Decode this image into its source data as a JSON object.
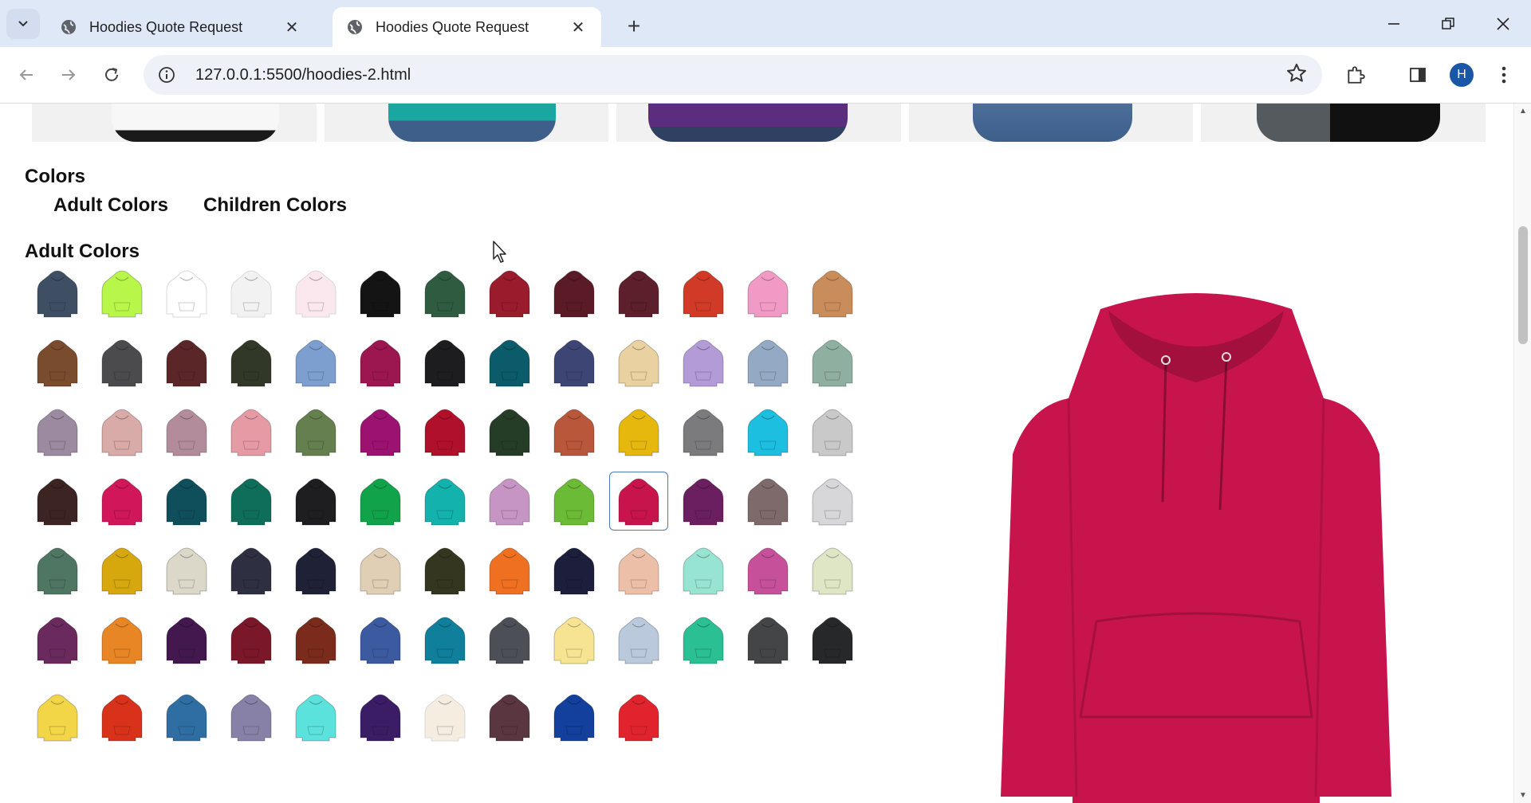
{
  "browser": {
    "tabs": [
      {
        "title": "Hoodies Quote Request",
        "active": false
      },
      {
        "title": "Hoodies Quote Request",
        "active": true
      }
    ],
    "url": "127.0.0.1:5500/hoodies-2.html",
    "profile_initial": "H"
  },
  "page": {
    "colors_heading": "Colors",
    "color_tabs": [
      "Adult Colors",
      "Children Colors"
    ],
    "adult_heading": "Adult Colors",
    "selected_color": "#c8144c",
    "strip_colors": [
      "#f6f6f6",
      "#1aa7a0",
      "#5c2d7e",
      "#3e5f8a",
      "#555a5e"
    ],
    "adult_colors": [
      [
        "#3f4f63",
        "#b8f74a",
        "#ffffff",
        "#f2f2f2",
        "#fbe7ee",
        "#141414",
        "#2f5b40",
        "#9a1b2c",
        "#5a1a26",
        "#5c1f2b",
        "#d23a28",
        "#f19ac6",
        "#c98d5c"
      ],
      [
        "#7a4c2e",
        "#4b4b4d",
        "#5b2628",
        "#323828",
        "#7d9fcf",
        "#9c1650",
        "#1d1d1f",
        "#0b5b6b",
        "#3d4574",
        "#e9d1a1",
        "#b29bd6",
        "#93a9c4",
        "#8fb0a0"
      ],
      [
        "#9c8aa1",
        "#d8aaa8",
        "#b38c9b",
        "#e59aa4",
        "#667f4e",
        "#9c1271",
        "#b0102a",
        "#253d27",
        "#b8573a",
        "#e6b80d",
        "#7b7b7d",
        "#1cbfe0",
        "#c9c9c9"
      ],
      [
        "#3b2422",
        "#d11659",
        "#0f4f5b",
        "#0f6e5a",
        "#1e1e20",
        "#11a34a",
        "#14b2ad",
        "#c795c4",
        "#6cbb36",
        "#c8144c",
        "#6b1f60",
        "#7e6a6a",
        "#d7d7d9"
      ],
      [
        "#4f7563",
        "#d7a80e",
        "#dcd8c9",
        "#2e2f40",
        "#1f2236",
        "#e1cfb5",
        "#353620",
        "#f07022",
        "#1c1e3c",
        "#ecc0a8",
        "#97e4d2",
        "#c7509b",
        "#dfe6c5"
      ],
      [
        "#6b2a5e",
        "#e88625",
        "#43184f",
        "#7a1729",
        "#7a2b1c",
        "#3c5aa0",
        "#0f7f9b",
        "#4d4f57",
        "#f6e493",
        "#bac9db",
        "#2bbf94",
        "#434546",
        "#27282a"
      ],
      [
        "#f2d648",
        "#d9321b",
        "#2f6ea3",
        "#8781a8",
        "#5ce2dc",
        "#3b1d66",
        "#f5ede0",
        "#5a3640",
        "#12409c",
        "#e1232e"
      ]
    ]
  }
}
